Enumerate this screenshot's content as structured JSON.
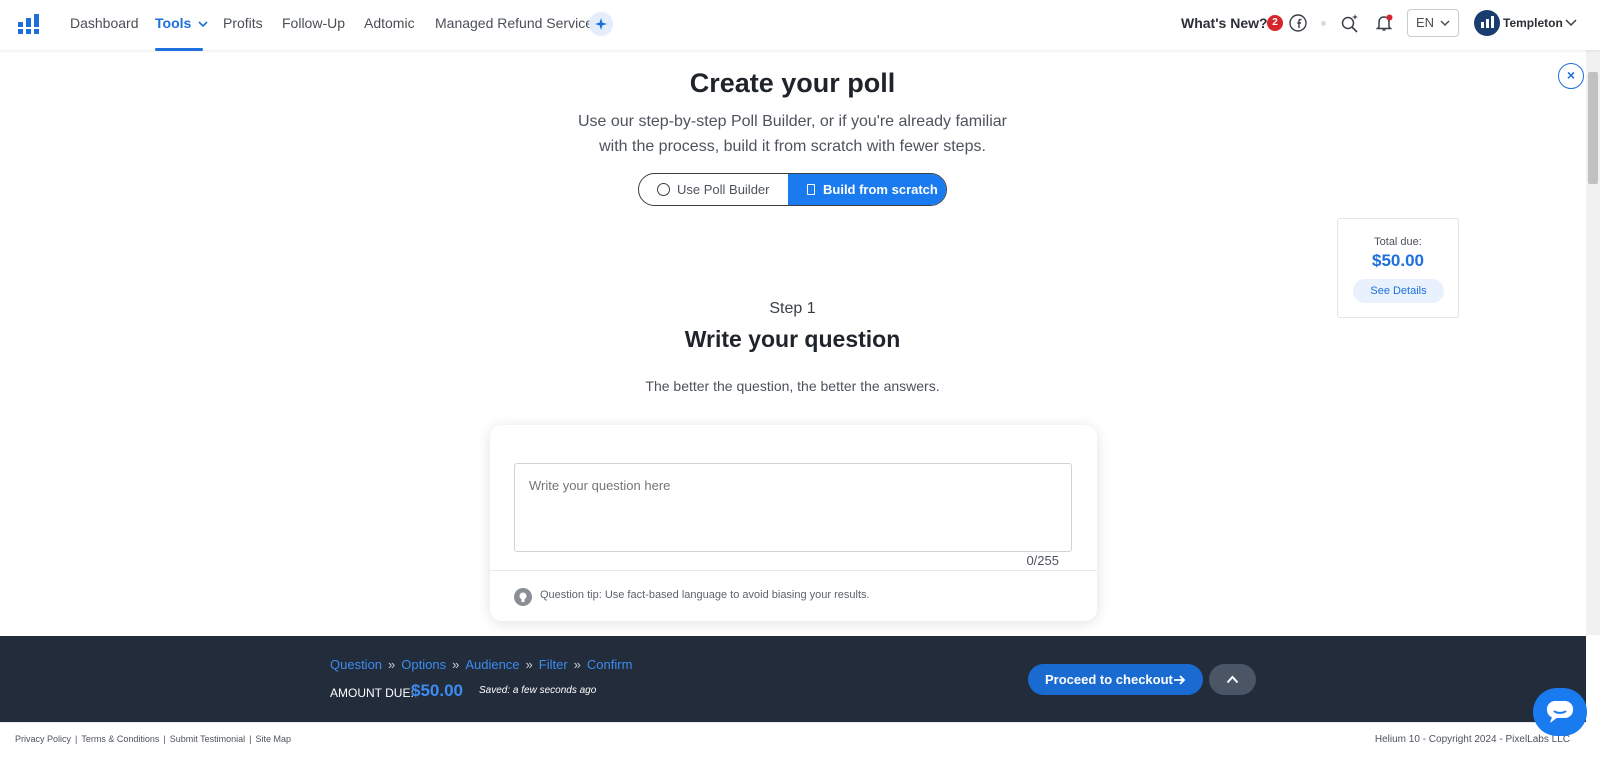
{
  "nav": {
    "items": [
      "Dashboard",
      "Tools",
      "Profits",
      "Follow-Up",
      "Adtomic",
      "Managed Refund Service"
    ],
    "whats_new": "What's New?",
    "whats_new_count": "2",
    "language": "EN",
    "user": "Templeton"
  },
  "hero": {
    "title": "Create your poll",
    "subtitle_line1": "Use our step-by-step Poll Builder, or if you're already familiar",
    "subtitle_line2": "with the process, build it from scratch with fewer steps.",
    "option_builder": "Use Poll Builder",
    "option_scratch": "Build from scratch"
  },
  "total": {
    "label": "Total due:",
    "amount": "$50.00",
    "details": "See Details"
  },
  "step": {
    "label": "Step 1",
    "title": "Write your question",
    "subtitle": "The better the question, the better the answers.",
    "placeholder": "Write your question here",
    "counter": "0/255",
    "tip": "Question tip: Use fact-based language to avoid biasing your results."
  },
  "footer": {
    "crumbs": [
      "Question",
      "Options",
      "Audience",
      "Filter",
      "Confirm"
    ],
    "separator": "»",
    "amount_label": "AMOUNT DUE:",
    "amount": "$50.00",
    "saved": "Saved: a few seconds ago",
    "checkout": "Proceed to checkout"
  },
  "bottom": {
    "links": [
      "Privacy Policy",
      "Terms & Conditions",
      "Submit Testimonial",
      "Site Map"
    ],
    "copyright": "Helium 10 - Copyright 2024 - PixelLabs LLC"
  },
  "colors": {
    "accent": "#1a7af0",
    "footer_bg": "#222c3a",
    "badge": "#d7262b"
  }
}
